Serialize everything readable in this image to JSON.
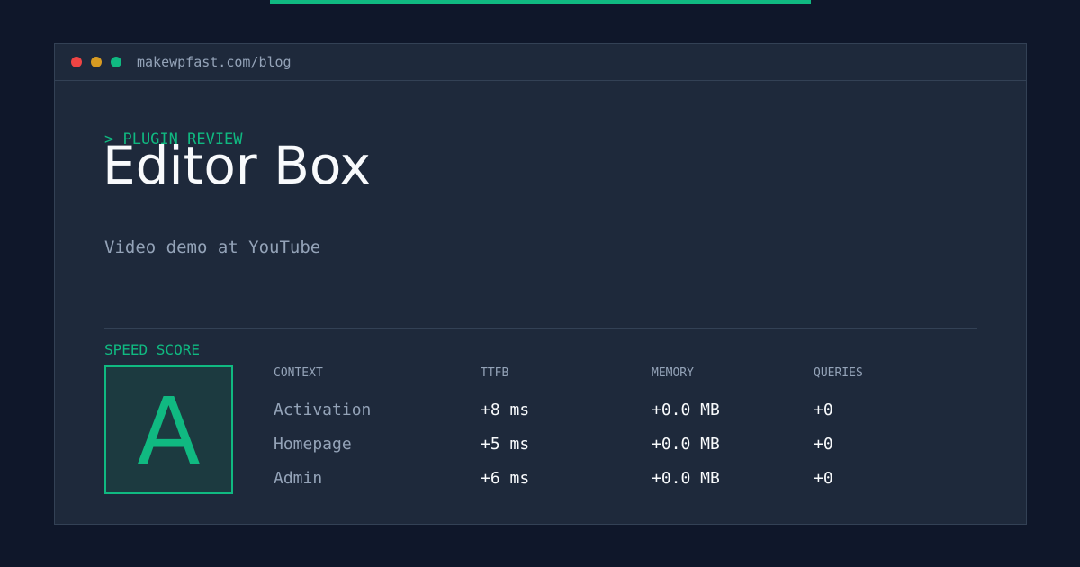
{
  "window": {
    "url": "makewpfast.com/blog"
  },
  "hero": {
    "eyebrow": "> PLUGIN REVIEW",
    "title": "Editor Box",
    "subtitle": "Video demo at YouTube"
  },
  "score": {
    "label": "SPEED SCORE",
    "grade": "A"
  },
  "table": {
    "headers": [
      "CONTEXT",
      "TTFB",
      "MEMORY",
      "QUERIES"
    ],
    "rows": [
      {
        "context": "Activation",
        "ttfb": "+8 ms",
        "memory": "+0.0 MB",
        "queries": "+0"
      },
      {
        "context": "Homepage",
        "ttfb": "+5 ms",
        "memory": "+0.0 MB",
        "queries": "+0"
      },
      {
        "context": "Admin",
        "ttfb": "+6 ms",
        "memory": "+0.0 MB",
        "queries": "+0"
      }
    ]
  },
  "colors": {
    "accent": "#10b981",
    "background": "#0f172a",
    "panel": "#1e293b",
    "close_dot": "#ef4444",
    "minimize_dot": "#d79b22",
    "maximize_dot": "#10b981"
  }
}
